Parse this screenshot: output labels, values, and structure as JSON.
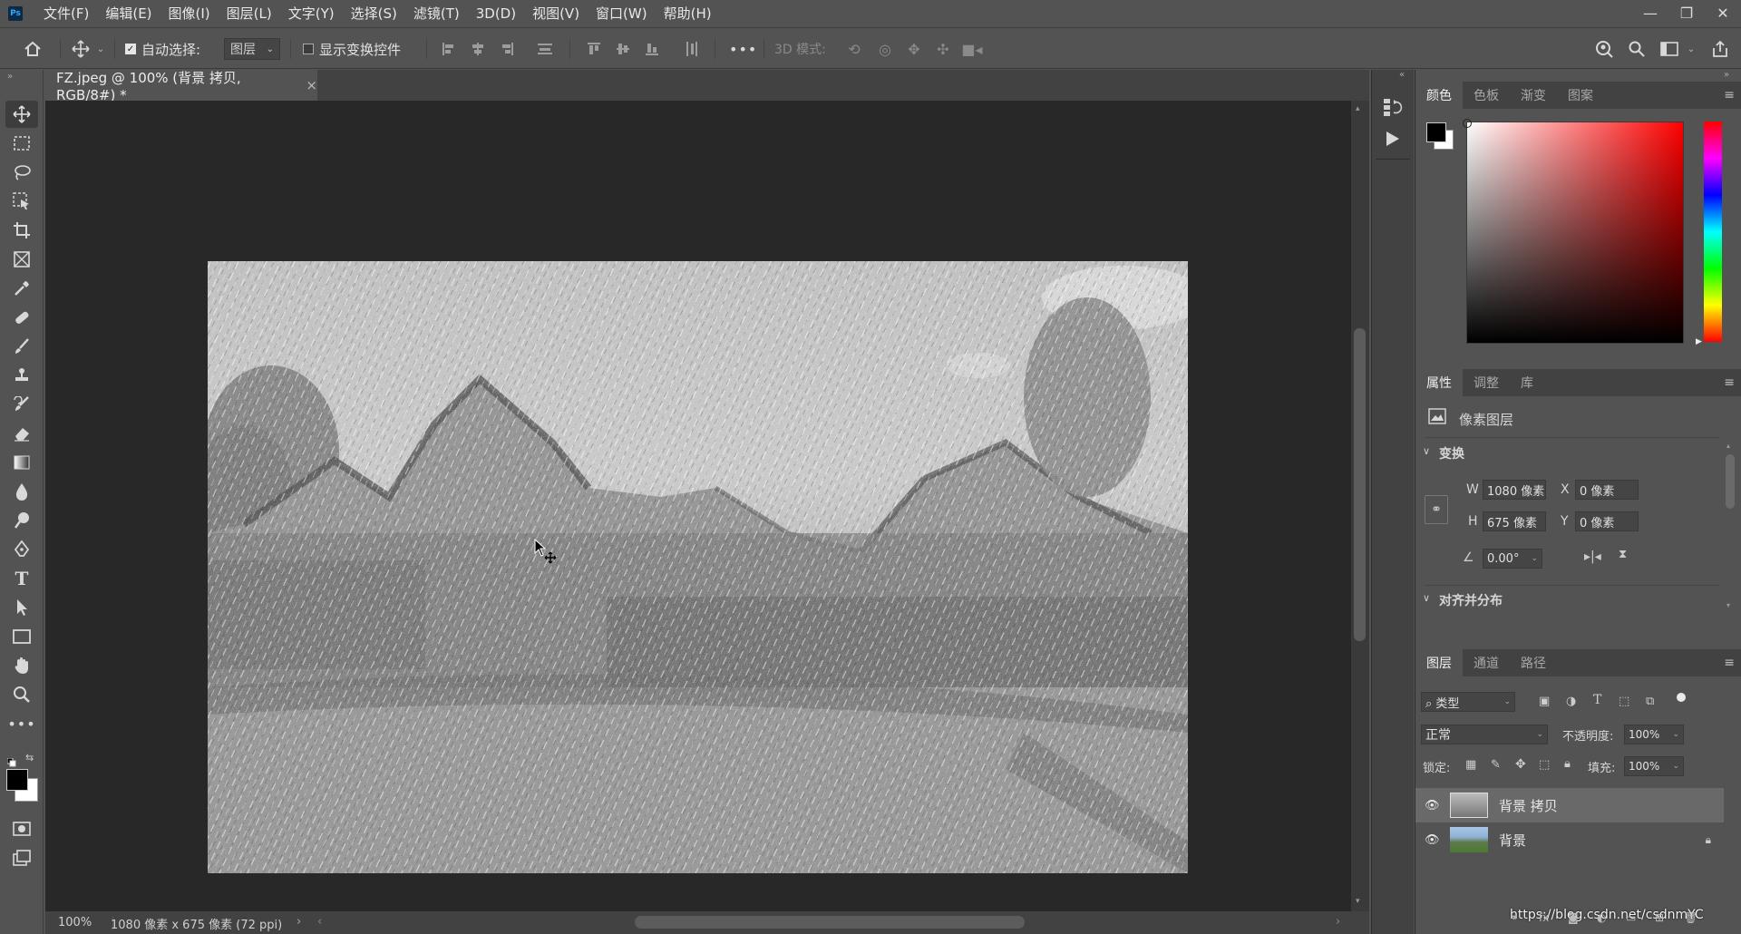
{
  "app": {
    "logo": "Ps"
  },
  "menu": [
    "文件(F)",
    "编辑(E)",
    "图像(I)",
    "图层(L)",
    "文字(Y)",
    "选择(S)",
    "滤镜(T)",
    "3D(D)",
    "视图(V)",
    "窗口(W)",
    "帮助(H)"
  ],
  "window_controls": {
    "minimize": "—",
    "restore": "❐",
    "close": "✕"
  },
  "options": {
    "auto_select_label": "自动选择:",
    "auto_select_value": "图层",
    "show_transform_label": "显示变换控件",
    "more": "•••",
    "mode_3d_label": "3D 模式:"
  },
  "document": {
    "tab_title": "FZ.jpeg @ 100% (背景 拷贝, RGB/8#) *",
    "tab_close": "×",
    "zoom": "100%",
    "doc_info": "1080 像素 x 675 像素 (72 ppi)"
  },
  "color_panel": {
    "tabs": [
      "颜色",
      "色板",
      "渐变",
      "图案"
    ],
    "active": "颜色",
    "foreground": "#000000",
    "background": "#ffffff"
  },
  "properties_panel": {
    "tabs": [
      "属性",
      "调整",
      "库"
    ],
    "layer_type": "像素图层",
    "transform_title": "变换",
    "w_label": "W",
    "w_value": "1080 像素",
    "h_label": "H",
    "h_value": "675 像素",
    "x_label": "X",
    "x_value": "0 像素",
    "y_label": "Y",
    "y_value": "0 像素",
    "angle_value": "0.00°",
    "align_title": "对齐并分布"
  },
  "layers_panel": {
    "tabs": [
      "图层",
      "通道",
      "路径"
    ],
    "filter_kind": "类型",
    "blend_mode": "正常",
    "opacity_label": "不透明度:",
    "opacity_value": "100%",
    "lock_label": "锁定:",
    "fill_label": "填充:",
    "fill_value": "100%",
    "layers": [
      {
        "name": "背景 拷贝",
        "selected": true,
        "locked": false
      },
      {
        "name": "背景",
        "selected": false,
        "locked": true
      }
    ]
  },
  "watermark": "https://blog.csdn.net/csdnmYC"
}
